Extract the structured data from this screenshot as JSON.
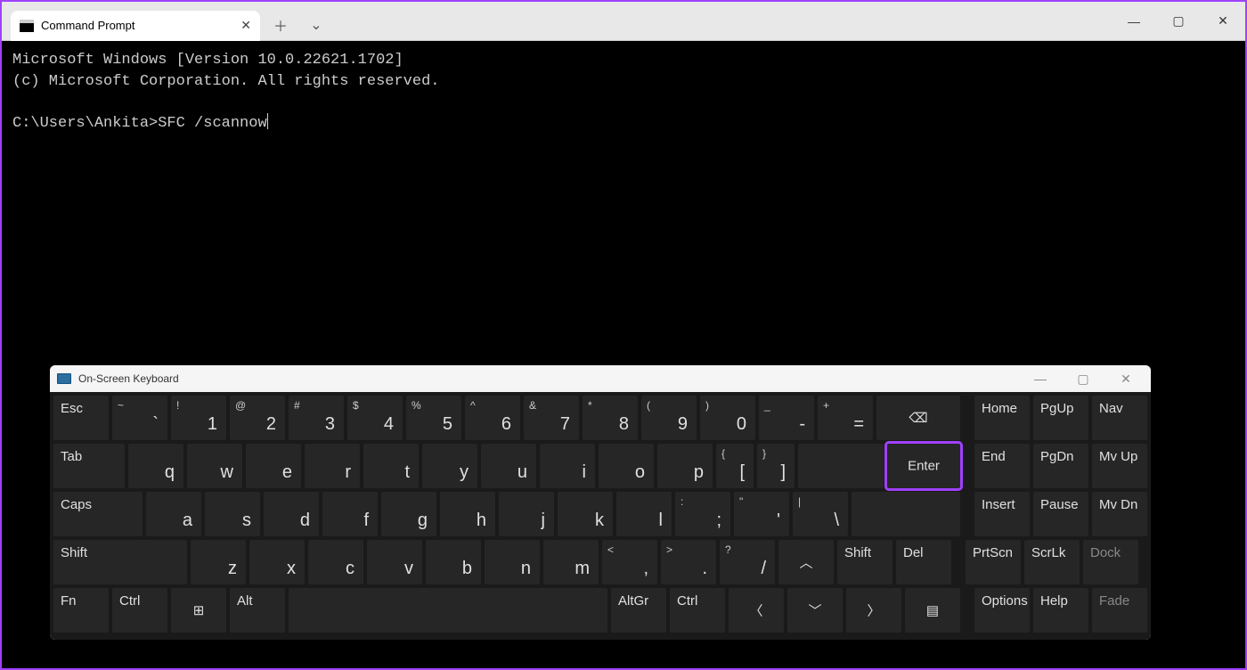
{
  "titlebar": {
    "tab_title": "Command Prompt"
  },
  "terminal": {
    "line1": "Microsoft Windows [Version 10.0.22621.1702]",
    "line2": "(c) Microsoft Corporation. All rights reserved.",
    "prompt": "C:\\Users\\Ankita>",
    "command": "SFC /scannow"
  },
  "osk": {
    "title": "On-Screen Keyboard",
    "keys": {
      "esc": "Esc",
      "tab": "Tab",
      "caps": "Caps",
      "shift": "Shift",
      "fn": "Fn",
      "ctrl": "Ctrl",
      "alt": "Alt",
      "altgr": "AltGr",
      "del": "Del",
      "enter": "Enter",
      "home": "Home",
      "pgup": "PgUp",
      "nav": "Nav",
      "end": "End",
      "pgdn": "PgDn",
      "mvup": "Mv Up",
      "insert": "Insert",
      "pause": "Pause",
      "mvdn": "Mv Dn",
      "prtscn": "PrtScn",
      "scrlk": "ScrLk",
      "dock": "Dock",
      "options": "Options",
      "help": "Help",
      "fade": "Fade",
      "r1": [
        {
          "s": "~",
          "m": "`"
        },
        {
          "s": "!",
          "m": "1"
        },
        {
          "s": "@",
          "m": "2"
        },
        {
          "s": "#",
          "m": "3"
        },
        {
          "s": "$",
          "m": "4"
        },
        {
          "s": "%",
          "m": "5"
        },
        {
          "s": "^",
          "m": "6"
        },
        {
          "s": "&",
          "m": "7"
        },
        {
          "s": "*",
          "m": "8"
        },
        {
          "s": "(",
          "m": "9"
        },
        {
          "s": ")",
          "m": "0"
        },
        {
          "s": "_",
          "m": "-"
        },
        {
          "s": "+",
          "m": "="
        }
      ],
      "r2": [
        "q",
        "w",
        "e",
        "r",
        "t",
        "y",
        "u",
        "i",
        "o",
        "p"
      ],
      "r2b": [
        {
          "s": "{",
          "m": "["
        },
        {
          "s": "}",
          "m": "]"
        }
      ],
      "r3": [
        "a",
        "s",
        "d",
        "f",
        "g",
        "h",
        "j",
        "k",
        "l"
      ],
      "r3b": [
        {
          "s": ":",
          "m": ";"
        },
        {
          "s": "\"",
          "m": "'"
        },
        {
          "s": "|",
          "m": "\\"
        }
      ],
      "r4": [
        "z",
        "x",
        "c",
        "v",
        "b",
        "n",
        "m"
      ],
      "r4b": [
        {
          "s": "<",
          "m": ","
        },
        {
          "s": ">",
          "m": "."
        },
        {
          "s": "?",
          "m": "/"
        }
      ]
    }
  }
}
